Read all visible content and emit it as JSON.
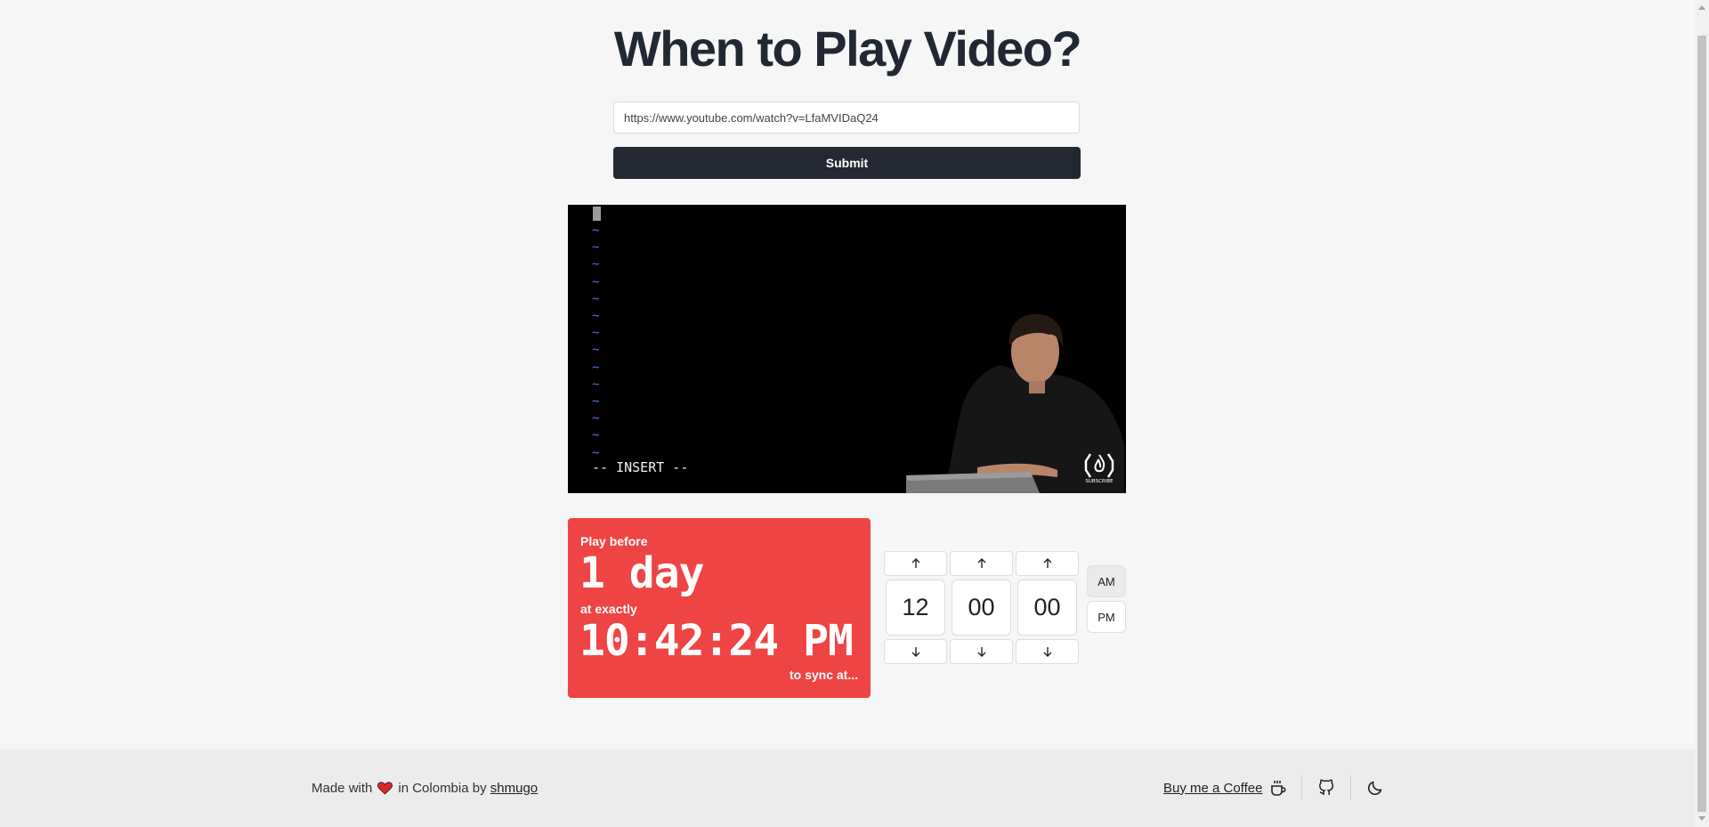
{
  "title": "When to Play Video?",
  "form": {
    "url_value": "https://www.youtube.com/watch?v=LfaMVIDaQ24",
    "submit_label": "Submit"
  },
  "video": {
    "insert_text": "-- INSERT --",
    "tildes": "~\n~\n~\n~\n~\n~\n~\n~\n~\n~\n~\n~\n~\n~",
    "logo": "subscribe-logo",
    "logo_text": "SUBSCRIBE"
  },
  "countdown": {
    "line1": "Play before",
    "days": "1 day",
    "line2": "at exactly",
    "time": "10:42:24 PM",
    "line3": "to sync at...",
    "background": "#ef4444"
  },
  "picker": {
    "hours": "12",
    "minutes": "00",
    "seconds": "00",
    "am_label": "AM",
    "pm_label": "PM",
    "selected": "AM"
  },
  "footer": {
    "made_with": "Made with",
    "in_text": "in Colombia by",
    "author": "shmugo",
    "coffee_label": "Buy me a Coffee",
    "icons": [
      "heart-icon",
      "coffee-icon",
      "github-icon",
      "moon-icon"
    ]
  }
}
